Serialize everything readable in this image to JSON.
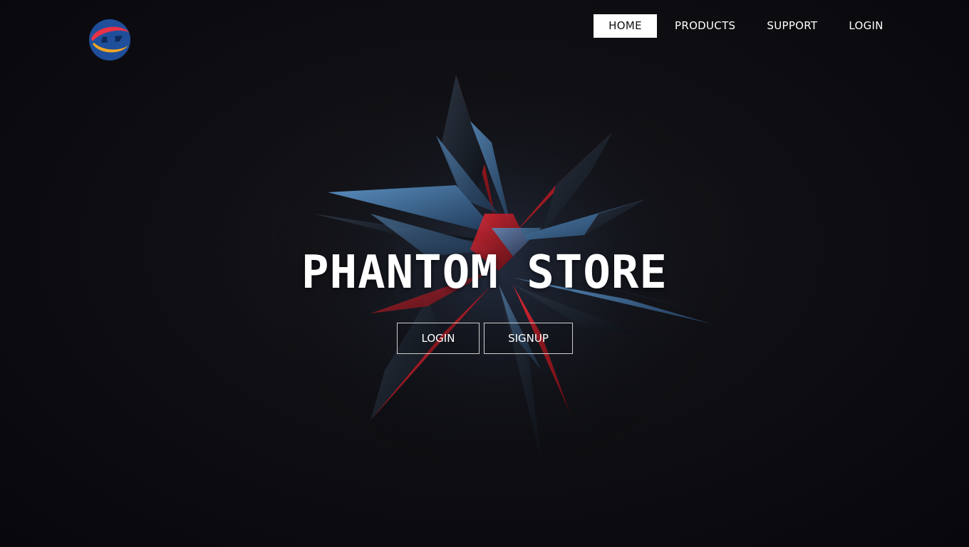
{
  "nav": {
    "items": [
      {
        "label": "HOME"
      },
      {
        "label": "PRODUCTS"
      },
      {
        "label": "SUPPORT"
      },
      {
        "label": "LOGIN"
      }
    ]
  },
  "hero": {
    "title": "PHANTOM STORE",
    "login_label": "LOGIN",
    "signup_label": "SIGNUP"
  },
  "colors": {
    "background": "#0a0a0d",
    "accent_red": "#d0202a",
    "accent_blue": "#3d6fa8",
    "text": "#ffffff"
  }
}
